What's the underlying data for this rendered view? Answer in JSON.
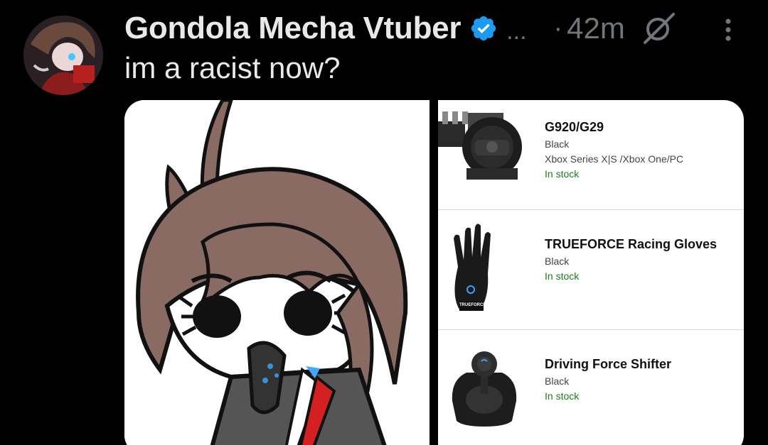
{
  "post": {
    "display_name": "Gondola Mecha Vtuber",
    "handle_truncation": "...",
    "separator": "·",
    "timestamp": "42m",
    "text": "im a racist now?"
  },
  "icons": {
    "verified": "verified-badge-icon",
    "grok": "grok-icon",
    "more": "more-vertical-icon"
  },
  "colors": {
    "background": "#000000",
    "primary_text": "#e7e9ea",
    "secondary_text": "#71767b",
    "verified_blue": "#1d9bf0",
    "in_stock_green": "#1a7f1a"
  },
  "products": [
    {
      "name": "G920/G29",
      "color": "Black",
      "compatibility": "Xbox Series X|S /Xbox One/PC",
      "stock": "In stock"
    },
    {
      "name": "TRUEFORCE Racing Gloves",
      "color": "Black",
      "stock": "In stock"
    },
    {
      "name": "Driving Force Shifter",
      "color": "Black",
      "stock": "In stock"
    }
  ],
  "glove_logo_text": "TRUEFORCE"
}
